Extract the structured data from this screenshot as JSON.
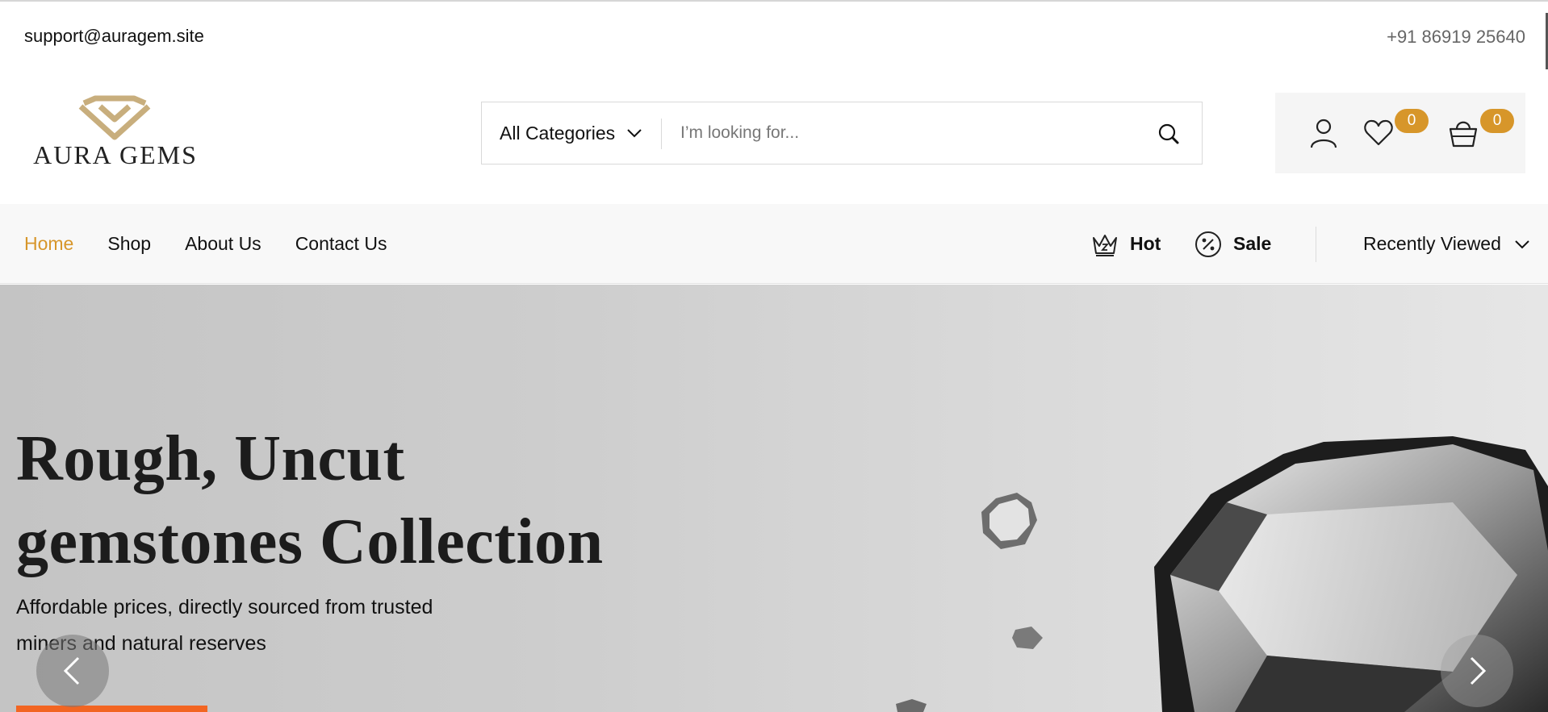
{
  "topbar": {
    "email": "support@auragem.site",
    "phone": "+91 86919 25640"
  },
  "logo": {
    "text": "AURA GEMS",
    "color": "#c8ae7d"
  },
  "search": {
    "category_label": "All Categories",
    "placeholder": "I’m looking for...",
    "value": ""
  },
  "actions": {
    "user_icon": "user-icon",
    "wishlist_icon": "heart-icon",
    "wishlist_count": "0",
    "cart_icon": "basket-icon",
    "cart_count": "0",
    "badge_color": "#d7962a"
  },
  "nav": {
    "links": [
      {
        "label": "Home",
        "active": true
      },
      {
        "label": "Shop",
        "active": false
      },
      {
        "label": "About Us",
        "active": false
      },
      {
        "label": "Contact Us",
        "active": false
      }
    ],
    "hot_label": "Hot",
    "sale_label": "Sale",
    "recently_viewed_label": "Recently Viewed",
    "active_color": "#d7962a"
  },
  "hero": {
    "title_line1": "Rough, Uncut",
    "title_line2": "gemstones Collection",
    "subtitle_line1": "Affordable prices, directly sourced from trusted",
    "subtitle_line2": "miners and natural reserves",
    "cta_color": "#f26522",
    "prev_icon": "chevron-left-icon",
    "next_icon": "chevron-right-icon"
  }
}
